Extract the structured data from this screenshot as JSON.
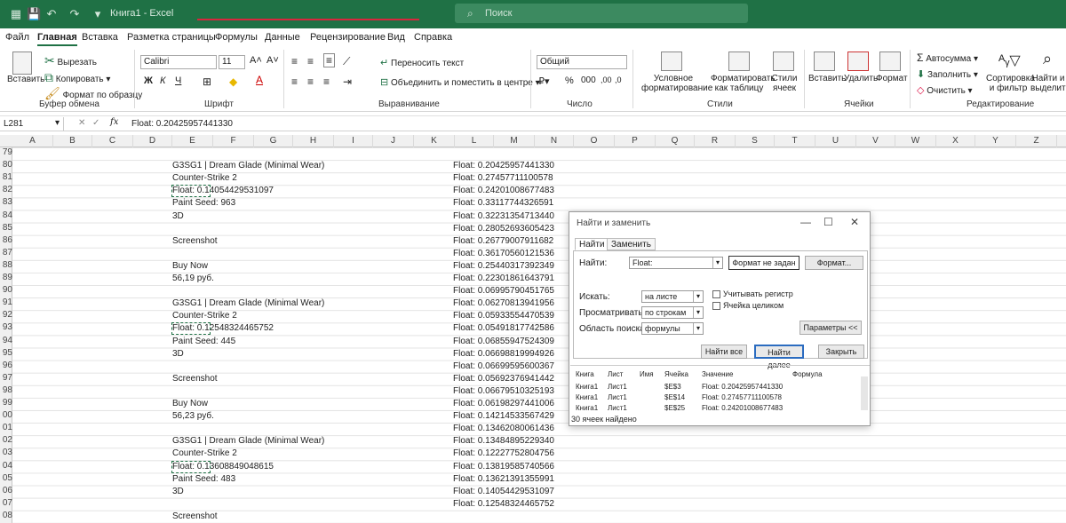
{
  "titlebar": {
    "doc_title": "Книга1 - Excel",
    "search_placeholder": "Поиск"
  },
  "menu": [
    "Файл",
    "Главная",
    "Вставка",
    "Разметка страницы",
    "Формулы",
    "Данные",
    "Рецензирование",
    "Вид",
    "Справка"
  ],
  "ribbon": {
    "clipboard": {
      "paste": "Вставить",
      "cut": "Вырезать",
      "copy": "Копировать",
      "format_painter": "Формат по образцу",
      "group": "Буфер обмена"
    },
    "font": {
      "name": "Calibri",
      "size": "11",
      "bold": "Ж",
      "italic": "К",
      "underline": "Ч",
      "group": "Шрифт"
    },
    "alignment": {
      "wrap": "Переносить текст",
      "merge": "Объединить и поместить в центре",
      "group": "Выравнивание"
    },
    "number": {
      "format": "Общий",
      "group": "Число"
    },
    "styles": {
      "conditional": "Условное форматирование",
      "as_table": "Форматировать как таблицу",
      "cell_styles": "Стили ячеек",
      "group": "Стили"
    },
    "cells": {
      "insert": "Вставить",
      "delete": "Удалить",
      "format": "Формат",
      "group": "Ячейки"
    },
    "editing": {
      "autosum": "Автосумма",
      "fill": "Заполнить",
      "clear": "Очистить",
      "sort": "Сортировка и фильтр",
      "find": "Найти и выделить",
      "group": "Редактирование"
    }
  },
  "formula_bar": {
    "name_box": "L281",
    "fx": "fx",
    "formula": "Float: 0.20425957441330"
  },
  "columns": [
    "A",
    "B",
    "C",
    "D",
    "E",
    "F",
    "G",
    "H",
    "I",
    "J",
    "K",
    "L",
    "M",
    "N",
    "O",
    "P",
    "Q",
    "R",
    "S",
    "T",
    "U",
    "V",
    "W",
    "X",
    "Y",
    "Z"
  ],
  "rows": [
    "79",
    "80",
    "81",
    "82",
    "83",
    "84",
    "85",
    "86",
    "87",
    "88",
    "89",
    "90",
    "91",
    "92",
    "93",
    "94",
    "95",
    "96",
    "97",
    "98",
    "99",
    "00",
    "01",
    "02",
    "03",
    "04",
    "05",
    "06",
    "07",
    "08"
  ],
  "col_e": [
    "",
    "G3SG1 | Dream Glade (Minimal Wear)",
    "Counter-Strike 2",
    "Float: 0.14054429531097",
    "Paint Seed: 963",
    "3D",
    "",
    "Screenshot",
    "",
    "Buy Now",
    "56,19 руб.",
    "",
    "G3SG1 | Dream Glade (Minimal Wear)",
    "Counter-Strike 2",
    "Float: 0.12548324465752",
    "Paint Seed: 445",
    "3D",
    "",
    "Screenshot",
    "",
    "Buy Now",
    "56,23 руб.",
    "",
    "G3SG1 | Dream Glade (Minimal Wear)",
    "Counter-Strike 2",
    "Float: 0.13608849048615",
    "Paint Seed: 483",
    "3D",
    "",
    "Screenshot"
  ],
  "col_l": [
    "",
    "Float: 0.20425957441330",
    "Float: 0.27457711100578",
    "Float: 0.24201008677483",
    "Float: 0.33117744326591",
    "Float: 0.32231354713440",
    "Float: 0.28052693605423",
    "Float: 0.26779007911682",
    "Float: 0.36170560121536",
    "Float: 0.25440317392349",
    "Float: 0.22301861643791",
    "Float: 0.06995790451765",
    "Float: 0.06270813941956",
    "Float: 0.05933554470539",
    "Float: 0.05491817742586",
    "Float: 0.06855947524309",
    "Float: 0.06698819994926",
    "Float: 0.06699595600367",
    "Float: 0.05692376941442",
    "Float: 0.06679510325193",
    "Float: 0.06198297441006",
    "Float: 0.14214533567429",
    "Float: 0.13462080061436",
    "Float: 0.13484895229340",
    "Float: 0.12227752804756",
    "Float: 0.13819585740566",
    "Float: 0.13621391355991",
    "Float: 0.14054429531097",
    "Float: 0.12548324465752"
  ],
  "dialog": {
    "title": "Найти и заменить",
    "tab_find": "Найти",
    "tab_replace": "Заменить",
    "find_label": "Найти:",
    "find_value": "Float:",
    "format_not_set": "Формат не задан",
    "format_btn": "Формат...",
    "within_label": "Искать:",
    "within_value": "на листе",
    "search_label": "Просматривать:",
    "search_value": "по строкам",
    "lookin_label": "Область поиска:",
    "lookin_value": "формулы",
    "match_case": "Учитывать регистр",
    "whole_cell": "Ячейка целиком",
    "options_btn": "Параметры <<",
    "find_all": "Найти все",
    "find_next": "Найти далее",
    "close": "Закрыть",
    "headers": [
      "Книга",
      "Лист",
      "Имя",
      "Ячейка",
      "Значение",
      "Формула"
    ],
    "results": [
      [
        "Книга1",
        "Лист1",
        "",
        "$E$3",
        "Float: 0.20425957441330"
      ],
      [
        "Книга1",
        "Лист1",
        "",
        "$E$14",
        "Float: 0.27457711100578"
      ],
      [
        "Книга1",
        "Лист1",
        "",
        "$E$25",
        "Float: 0.24201008677483"
      ]
    ],
    "status": "30 ячеек найдено"
  }
}
